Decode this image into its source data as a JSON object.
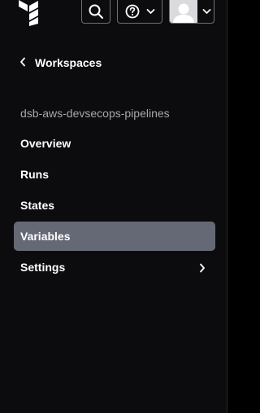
{
  "colors": {
    "background": "#0c0c0e",
    "active_item": "#656975",
    "text": "#ffffff",
    "muted_text": "#a6a6ad",
    "button_border": "#6f6f75"
  },
  "header": {
    "logo_icon": "terraform-logo-icon",
    "search_icon": "search-icon",
    "help_icon": "help-circle-icon",
    "user_icon": "user-avatar-icon"
  },
  "sidebar": {
    "back_label": "Workspaces",
    "workspace_name": "dsb-aws-devsecops-pipelines",
    "items": [
      {
        "label": "Overview",
        "active": false
      },
      {
        "label": "Runs",
        "active": false
      },
      {
        "label": "States",
        "active": false
      },
      {
        "label": "Variables",
        "active": true
      },
      {
        "label": "Settings",
        "active": false,
        "has_submenu": true
      }
    ]
  }
}
